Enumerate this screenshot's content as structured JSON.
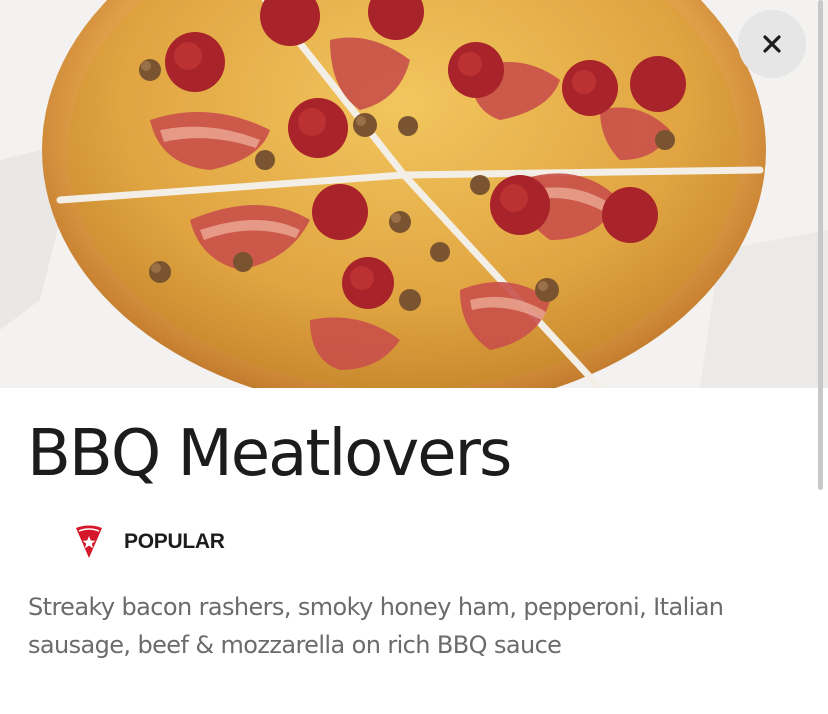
{
  "hero": {
    "image": "pizza-photo"
  },
  "close_button": {
    "icon": "close-icon",
    "icon_glyph": "✕"
  },
  "product": {
    "title": "BBQ Meatlovers",
    "badge": {
      "icon": "pizza-slice-star-icon",
      "label": "POPULAR",
      "accent_color": "#d6172a"
    },
    "description": "Streaky bacon rashers, smoky honey ham, pepperoni, Italian sausage, beef & mozzarella on rich BBQ sauce"
  }
}
